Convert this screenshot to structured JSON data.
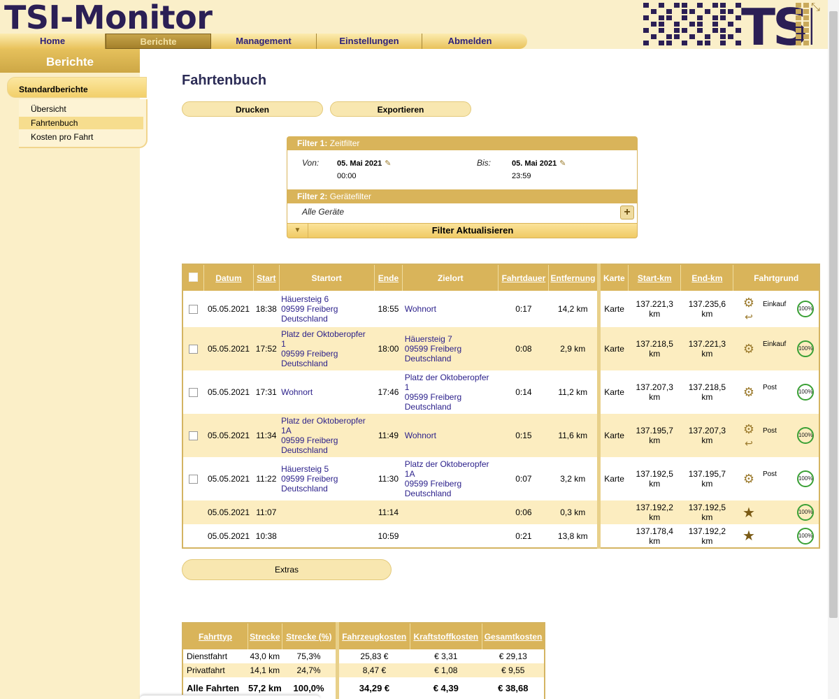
{
  "app": {
    "title": "TSI-Monitor",
    "brand": "TSI"
  },
  "nav": {
    "items": [
      "Home",
      "Berichte",
      "Management",
      "Einstellungen",
      "Abmelden"
    ],
    "active": "Berichte"
  },
  "sidebar": {
    "title": "Berichte",
    "section": "Standardberichte",
    "links": [
      "Übersicht",
      "Fahrtenbuch",
      "Kosten pro Fahrt"
    ],
    "active": "Fahrtenbuch"
  },
  "page": {
    "title": "Fahrtenbuch",
    "print_label": "Drucken",
    "export_label": "Exportieren",
    "extras_label": "Extras"
  },
  "filter": {
    "f1_prefix": "Filter 1:",
    "f1_name": "Zeitfilter",
    "from_label": "Von:",
    "from_date": "05. Mai 2021",
    "from_time": "00:00",
    "to_label": "Bis:",
    "to_date": "05. Mai 2021",
    "to_time": "23:59",
    "f2_prefix": "Filter 2:",
    "f2_name": "Gerätefilter",
    "devices": "Alle Geräte",
    "update_label": "Filter Aktualisieren"
  },
  "trips": {
    "headers": [
      "Datum",
      "Start",
      "Startort",
      "Ende",
      "Zielort",
      "Fahrtdauer",
      "Entfernung",
      "Karte",
      "Start-km",
      "End-km",
      "Fahrtgrund"
    ],
    "rows": [
      {
        "date": "05.05.2021",
        "start": "18:38",
        "from": [
          "Häuersteig 6",
          "09599 Freiberg",
          "Deutschland"
        ],
        "end": "18:55",
        "to": [
          "Wohnort"
        ],
        "duration": "0:17",
        "distance": "14,2 km",
        "map": "Karte",
        "km_start": [
          "137.221,3",
          "km"
        ],
        "km_end": [
          "137.235,6",
          "km"
        ],
        "reason": "Einkauf",
        "pct": "100%",
        "checkbox": true,
        "icons": "gear-undo"
      },
      {
        "date": "05.05.2021",
        "start": "17:52",
        "from": [
          "Platz der Oktoberopfer",
          "1",
          "09599 Freiberg",
          "Deutschland"
        ],
        "end": "18:00",
        "to": [
          "Häuersteig 7",
          "09599 Freiberg",
          "Deutschland"
        ],
        "duration": "0:08",
        "distance": "2,9 km",
        "map": "Karte",
        "km_start": [
          "137.218,5",
          "km"
        ],
        "km_end": [
          "137.221,3",
          "km"
        ],
        "reason": "Einkauf",
        "pct": "100%",
        "checkbox": true,
        "icons": "gear"
      },
      {
        "date": "05.05.2021",
        "start": "17:31",
        "from": [
          "Wohnort"
        ],
        "end": "17:46",
        "to": [
          "Platz der Oktoberopfer",
          "1",
          "09599 Freiberg",
          "Deutschland"
        ],
        "duration": "0:14",
        "distance": "11,2 km",
        "map": "Karte",
        "km_start": [
          "137.207,3",
          "km"
        ],
        "km_end": [
          "137.218,5",
          "km"
        ],
        "reason": "Post",
        "pct": "100%",
        "checkbox": true,
        "icons": "gear"
      },
      {
        "date": "05.05.2021",
        "start": "11:34",
        "from": [
          "Platz der Oktoberopfer",
          "1A",
          "09599 Freiberg",
          "Deutschland"
        ],
        "end": "11:49",
        "to": [
          "Wohnort"
        ],
        "duration": "0:15",
        "distance": "11,6 km",
        "map": "Karte",
        "km_start": [
          "137.195,7",
          "km"
        ],
        "km_end": [
          "137.207,3",
          "km"
        ],
        "reason": "Post",
        "pct": "100%",
        "checkbox": true,
        "icons": "gear-undo"
      },
      {
        "date": "05.05.2021",
        "start": "11:22",
        "from": [
          "Häuersteig 5",
          "09599 Freiberg",
          "Deutschland"
        ],
        "end": "11:30",
        "to": [
          "Platz der Oktoberopfer",
          "1A",
          "09599 Freiberg",
          "Deutschland"
        ],
        "duration": "0:07",
        "distance": "3,2 km",
        "map": "Karte",
        "km_start": [
          "137.192,5",
          "km"
        ],
        "km_end": [
          "137.195,7",
          "km"
        ],
        "reason": "Post",
        "pct": "100%",
        "checkbox": true,
        "icons": "gear"
      },
      {
        "date": "05.05.2021",
        "start": "11:07",
        "from": [],
        "end": "11:14",
        "to": [],
        "duration": "0:06",
        "distance": "0,3 km",
        "map": "",
        "km_start": [
          "137.192,2",
          "km"
        ],
        "km_end": [
          "137.192,5",
          "km"
        ],
        "reason": "",
        "pct": "100%",
        "checkbox": false,
        "icons": "star"
      },
      {
        "date": "05.05.2021",
        "start": "10:38",
        "from": [],
        "end": "10:59",
        "to": [],
        "duration": "0:21",
        "distance": "13,8 km",
        "map": "",
        "km_start": [
          "137.178,4",
          "km"
        ],
        "km_end": [
          "137.192,2",
          "km"
        ],
        "reason": "",
        "pct": "100%",
        "checkbox": false,
        "icons": "star"
      }
    ]
  },
  "summary": {
    "headers": [
      "Fahrttyp",
      "Strecke",
      "Strecke (%)",
      "Fahrzeugkosten",
      "Kraftstoffkosten",
      "Gesamtkosten"
    ],
    "rows": [
      [
        "Dienstfahrt",
        "43,0 km",
        "75,3%",
        "25,83 €",
        "€ 3,31",
        "€ 29,13"
      ],
      [
        "Privatfahrt",
        "14,1 km",
        "24,7%",
        "8,47 €",
        "€ 1,08",
        "€ 9,55"
      ]
    ],
    "total": [
      "Alle Fahrten",
      "57,2 km",
      "100,0%",
      "34,29 €",
      "€ 4,39",
      "€ 38,68"
    ]
  },
  "colors": {
    "accent": "#d9b45a",
    "background": "#faefc9",
    "link": "#2a1f8a",
    "title": "#2b1f55"
  }
}
